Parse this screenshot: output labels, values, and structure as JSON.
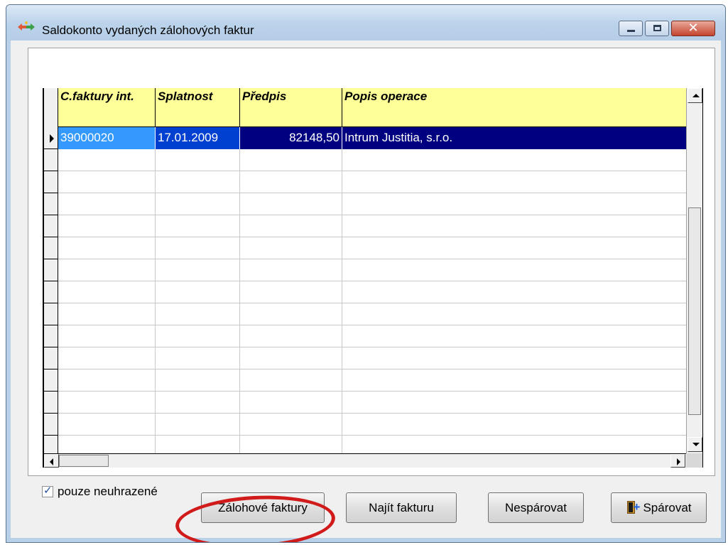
{
  "window": {
    "title": "Saldokonto vydaných zálohových faktur",
    "controls": {
      "minimize_icon": "minimize-icon",
      "maximize_icon": "maximize-icon",
      "close_glyph": "✕"
    }
  },
  "grid": {
    "columns": [
      "C.faktury int.",
      "Splatnost",
      "Předpis",
      "Popis operace"
    ],
    "rows": [
      {
        "cells": [
          "39000020",
          "17.01.2009",
          "82148,50",
          "Intrum Justitia, s.r.o."
        ],
        "selected": true
      }
    ],
    "header_color": "#ffff99",
    "selection_color": "#000080"
  },
  "footer": {
    "checkbox_label": "pouze neuhrazené",
    "checkbox_checked": true,
    "checkbox_mark": "✓",
    "buttons": {
      "zalohove": "Zálohové faktury",
      "najit": "Najít fakturu",
      "nesparovat": "Nespárovat",
      "sparovat": "Spárovat"
    }
  },
  "annotation": {
    "color": "#d11a1a"
  }
}
